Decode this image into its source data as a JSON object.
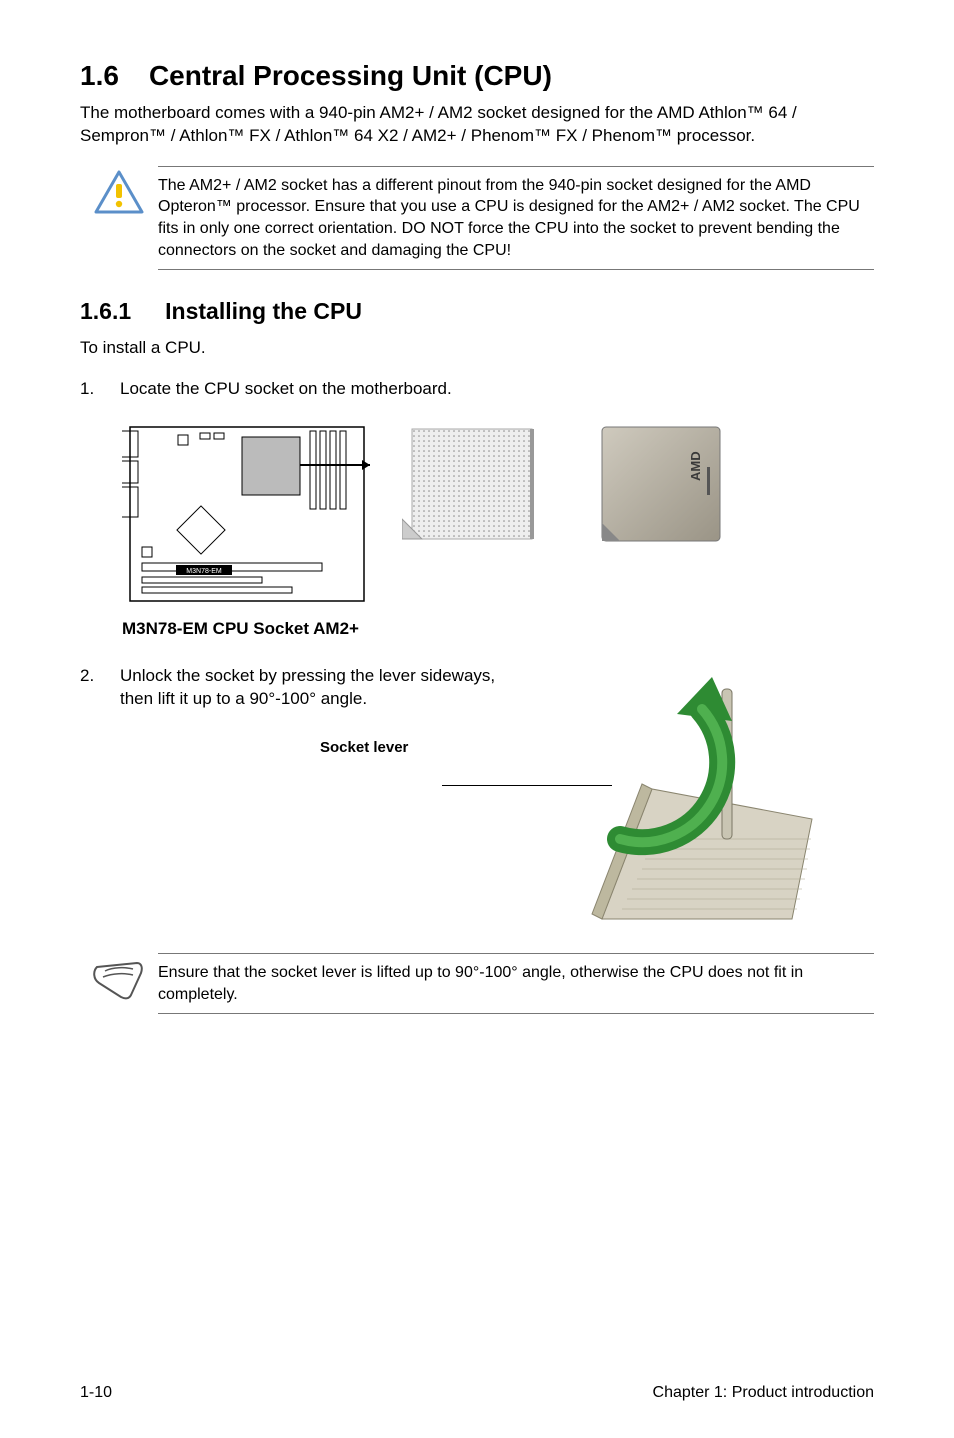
{
  "section": {
    "number": "1.6",
    "title": "Central Processing Unit (CPU)",
    "intro": "The motherboard comes with a 940-pin AM2+ / AM2 socket designed for the AMD Athlon™ 64 / Sempron™ / Athlon™ FX / Athlon™ 64 X2 / AM2+ / Phenom™ FX / Phenom™ processor."
  },
  "warning": {
    "text": "The AM2+ / AM2 socket has a different pinout from the 940-pin socket designed for the AMD Opteron™ processor. Ensure that you use a CPU is designed for the AM2+ / AM2 socket. The CPU fits in only one correct orientation. DO NOT force the CPU into the socket to prevent bending the connectors on the socket and damaging the CPU!"
  },
  "subsection": {
    "number": "1.6.1",
    "title": "Installing the CPU",
    "lead": "To install a CPU."
  },
  "steps": {
    "s1_num": "1.",
    "s1_text": "Locate the CPU socket on the motherboard.",
    "s2_num": "2.",
    "s2_text": "Unlock the socket by pressing the lever sideways, then lift it up to a 90°-100° angle."
  },
  "labels": {
    "board_model": "M3N78-EM",
    "caption": "M3N78-EM CPU Socket AM2+",
    "socket_lever": "Socket lever",
    "cpu_brand": "AMD"
  },
  "note": {
    "text": "Ensure that the socket  lever is lifted up to 90°-100° angle, otherwise the CPU does not fit in completely."
  },
  "footer": {
    "page": "1-10",
    "chapter": "Chapter 1: Product introduction"
  }
}
